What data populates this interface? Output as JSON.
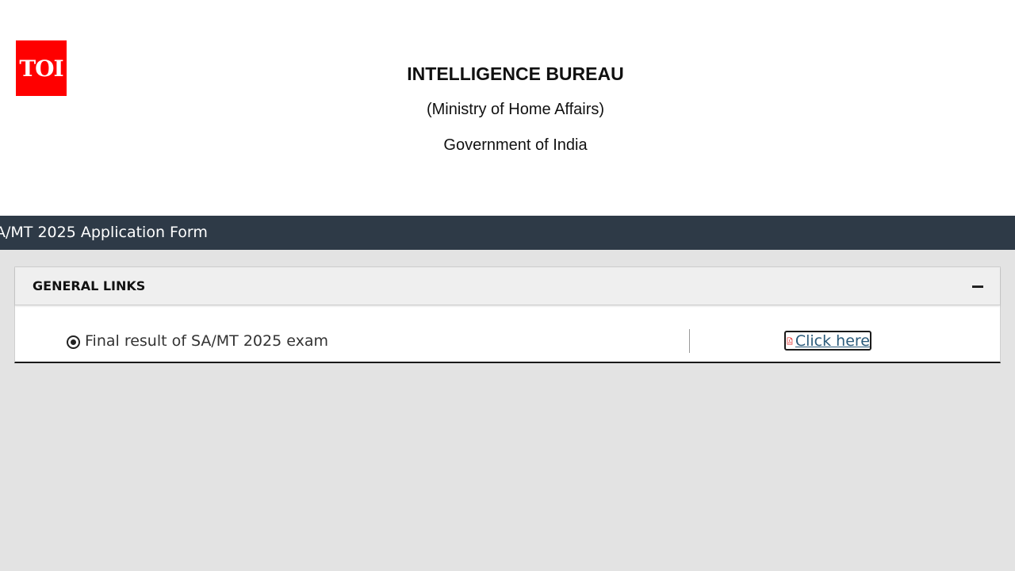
{
  "logo": {
    "text": "TOI",
    "color": "#ff0000"
  },
  "header": {
    "title": "INTELLIGENCE BUREAU",
    "ministry": "(Ministry of Home Affairs)",
    "government": "Government of India"
  },
  "navbar": {
    "title": "A/MT 2025 Application Form",
    "background": "#2e3a47"
  },
  "panel": {
    "title": "GENERAL LINKS",
    "collapse_icon": "minus-icon",
    "rows": [
      {
        "icon": "circle-dot-icon",
        "label": "Final result of SA/MT 2025 exam",
        "link_icon": "pdf-icon",
        "link_text": "Click here"
      }
    ]
  },
  "colors": {
    "page_background": "#e3e3e3",
    "link": "#2a5a7a",
    "pdf_icon": "#e02020"
  }
}
